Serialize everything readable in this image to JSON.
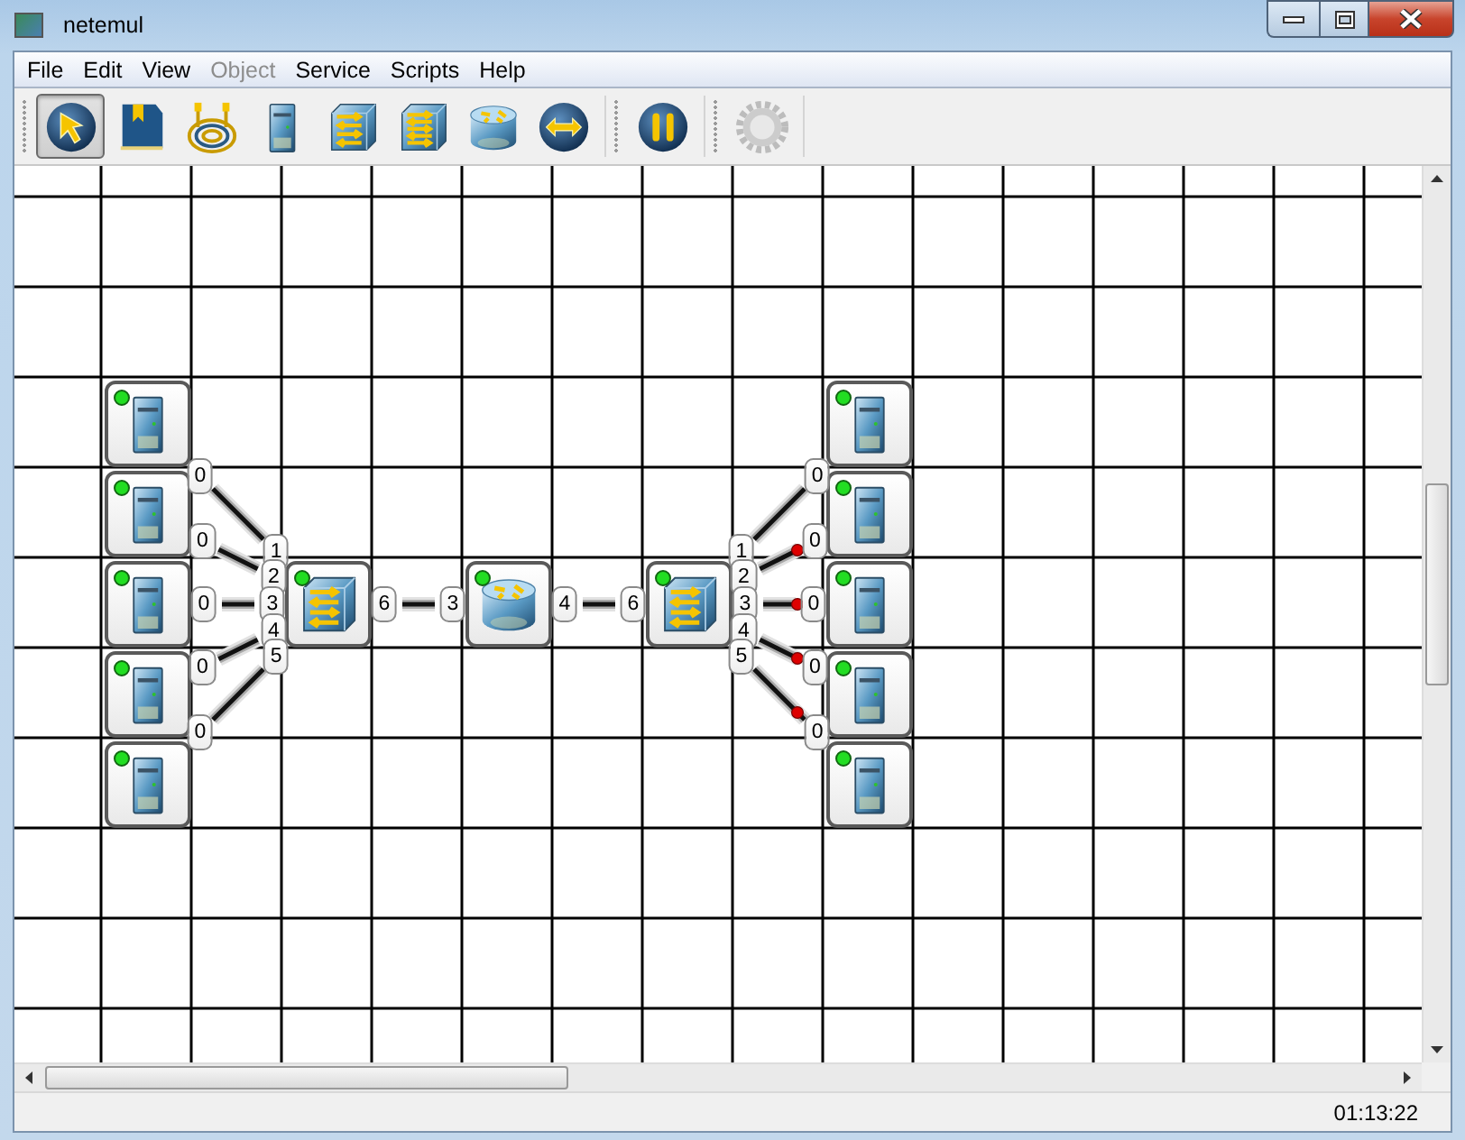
{
  "window": {
    "title": "netemul"
  },
  "menu": [
    {
      "label": "File",
      "disabled": false
    },
    {
      "label": "Edit",
      "disabled": false
    },
    {
      "label": "View",
      "disabled": false
    },
    {
      "label": "Object",
      "disabled": true
    },
    {
      "label": "Service",
      "disabled": false
    },
    {
      "label": "Scripts",
      "disabled": false
    },
    {
      "label": "Help",
      "disabled": false
    }
  ],
  "toolbar_groups": [
    {
      "buttons": [
        {
          "kind": "pointer",
          "selected": true,
          "disabled": false
        },
        {
          "kind": "note",
          "selected": false,
          "disabled": false
        },
        {
          "kind": "cable",
          "selected": false,
          "disabled": false
        },
        {
          "kind": "host",
          "selected": false,
          "disabled": false
        },
        {
          "kind": "switch",
          "selected": false,
          "disabled": false
        },
        {
          "kind": "hub",
          "selected": false,
          "disabled": false
        },
        {
          "kind": "router",
          "selected": false,
          "disabled": false
        },
        {
          "kind": "bridge",
          "selected": false,
          "disabled": false
        }
      ]
    },
    {
      "buttons": [
        {
          "kind": "pause",
          "selected": false,
          "disabled": false
        }
      ]
    },
    {
      "buttons": [
        {
          "kind": "settings",
          "selected": false,
          "disabled": true
        }
      ]
    }
  ],
  "canvas": {
    "devices": [
      {
        "kind": "host",
        "active": true
      },
      {
        "kind": "host",
        "active": true
      },
      {
        "kind": "host",
        "active": true
      },
      {
        "kind": "host",
        "active": true
      },
      {
        "kind": "host",
        "active": true
      },
      {
        "kind": "switch",
        "active": true
      },
      {
        "kind": "router",
        "active": true
      },
      {
        "kind": "switch",
        "active": true
      },
      {
        "kind": "host",
        "active": true
      },
      {
        "kind": "host",
        "active": true
      },
      {
        "kind": "host",
        "active": true
      },
      {
        "kind": "host",
        "active": true
      },
      {
        "kind": "host",
        "active": true
      }
    ],
    "links": [
      {
        "from_port": "0",
        "to_port": "1",
        "packet": false
      },
      {
        "from_port": "0",
        "to_port": "2",
        "packet": false
      },
      {
        "from_port": "0",
        "to_port": "3",
        "packet": false
      },
      {
        "from_port": "0",
        "to_port": "4",
        "packet": false
      },
      {
        "from_port": "0",
        "to_port": "5",
        "packet": false
      },
      {
        "from_port": "6",
        "to_port": "3",
        "packet": false
      },
      {
        "from_port": "4",
        "to_port": "6",
        "packet": false
      },
      {
        "from_port": "1",
        "to_port": "0",
        "packet": false
      },
      {
        "from_port": "2",
        "to_port": "0",
        "packet": true
      },
      {
        "from_port": "3",
        "to_port": "0",
        "packet": true
      },
      {
        "from_port": "4",
        "to_port": "0",
        "packet": true
      },
      {
        "from_port": "5",
        "to_port": "0",
        "packet": true
      }
    ]
  },
  "status_bar": {
    "time": "01:13:22"
  }
}
